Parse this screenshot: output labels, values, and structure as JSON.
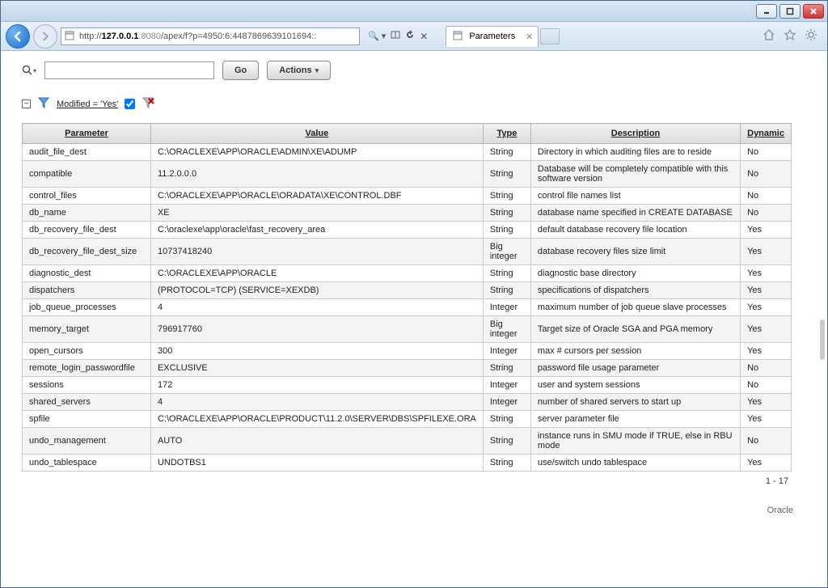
{
  "browser": {
    "url_display": "http://127.0.0.1:8080/apex/f?p=4950:6:4487869639101694::",
    "tab_title": "Parameters"
  },
  "search": {
    "go_label": "Go",
    "actions_label": "Actions",
    "placeholder": ""
  },
  "filter": {
    "label": "Modified = 'Yes'"
  },
  "columns": {
    "parameter": "Parameter",
    "value": "Value",
    "type": "Type",
    "description": "Description",
    "dynamic": "Dynamic"
  },
  "rows": [
    {
      "param": "audit_file_dest",
      "value": "C:\\ORACLEXE\\APP\\ORACLE\\ADMIN\\XE\\ADUMP",
      "type": "String",
      "desc": "Directory in which auditing files are to reside",
      "dyn": "No"
    },
    {
      "param": "compatible",
      "value": "11.2.0.0.0",
      "type": "String",
      "desc": "Database will be completely compatible with this software version",
      "dyn": "No"
    },
    {
      "param": "control_files",
      "value": "C:\\ORACLEXE\\APP\\ORACLE\\ORADATA\\XE\\CONTROL.DBF",
      "type": "String",
      "desc": "control file names list",
      "dyn": "No"
    },
    {
      "param": "db_name",
      "value": "XE",
      "type": "String",
      "desc": "database name specified in CREATE DATABASE",
      "dyn": "No"
    },
    {
      "param": "db_recovery_file_dest",
      "value": "C:\\oraclexe\\app\\oracle\\fast_recovery_area",
      "type": "String",
      "desc": "default database recovery file location",
      "dyn": "Yes"
    },
    {
      "param": "db_recovery_file_dest_size",
      "value": "10737418240",
      "type": "Big integer",
      "desc": "database recovery files size limit",
      "dyn": "Yes"
    },
    {
      "param": "diagnostic_dest",
      "value": "C:\\ORACLEXE\\APP\\ORACLE",
      "type": "String",
      "desc": "diagnostic base directory",
      "dyn": "Yes"
    },
    {
      "param": "dispatchers",
      "value": "(PROTOCOL=TCP) (SERVICE=XEXDB)",
      "type": "String",
      "desc": "specifications of dispatchers",
      "dyn": "Yes"
    },
    {
      "param": "job_queue_processes",
      "value": "4",
      "type": "Integer",
      "desc": "maximum number of job queue slave processes",
      "dyn": "Yes"
    },
    {
      "param": "memory_target",
      "value": "796917760",
      "type": "Big integer",
      "desc": "Target size of Oracle SGA and PGA memory",
      "dyn": "Yes"
    },
    {
      "param": "open_cursors",
      "value": "300",
      "type": "Integer",
      "desc": "max # cursors per session",
      "dyn": "Yes"
    },
    {
      "param": "remote_login_passwordfile",
      "value": "EXCLUSIVE",
      "type": "String",
      "desc": "password file usage parameter",
      "dyn": "No"
    },
    {
      "param": "sessions",
      "value": "172",
      "type": "Integer",
      "desc": "user and system sessions",
      "dyn": "No"
    },
    {
      "param": "shared_servers",
      "value": "4",
      "type": "Integer",
      "desc": "number of shared servers to start up",
      "dyn": "Yes"
    },
    {
      "param": "spfile",
      "value": "C:\\ORACLEXE\\APP\\ORACLE\\PRODUCT\\11.2.0\\SERVER\\DBS\\SPFILEXE.ORA",
      "type": "String",
      "desc": "server parameter file",
      "dyn": "Yes"
    },
    {
      "param": "undo_management",
      "value": "AUTO",
      "type": "String",
      "desc": "instance runs in SMU mode if TRUE, else in RBU mode",
      "dyn": "No"
    },
    {
      "param": "undo_tablespace",
      "value": "UNDOTBS1",
      "type": "String",
      "desc": "use/switch undo tablespace",
      "dyn": "Yes"
    }
  ],
  "pagination": "1 - 17",
  "footer": "Oracle"
}
